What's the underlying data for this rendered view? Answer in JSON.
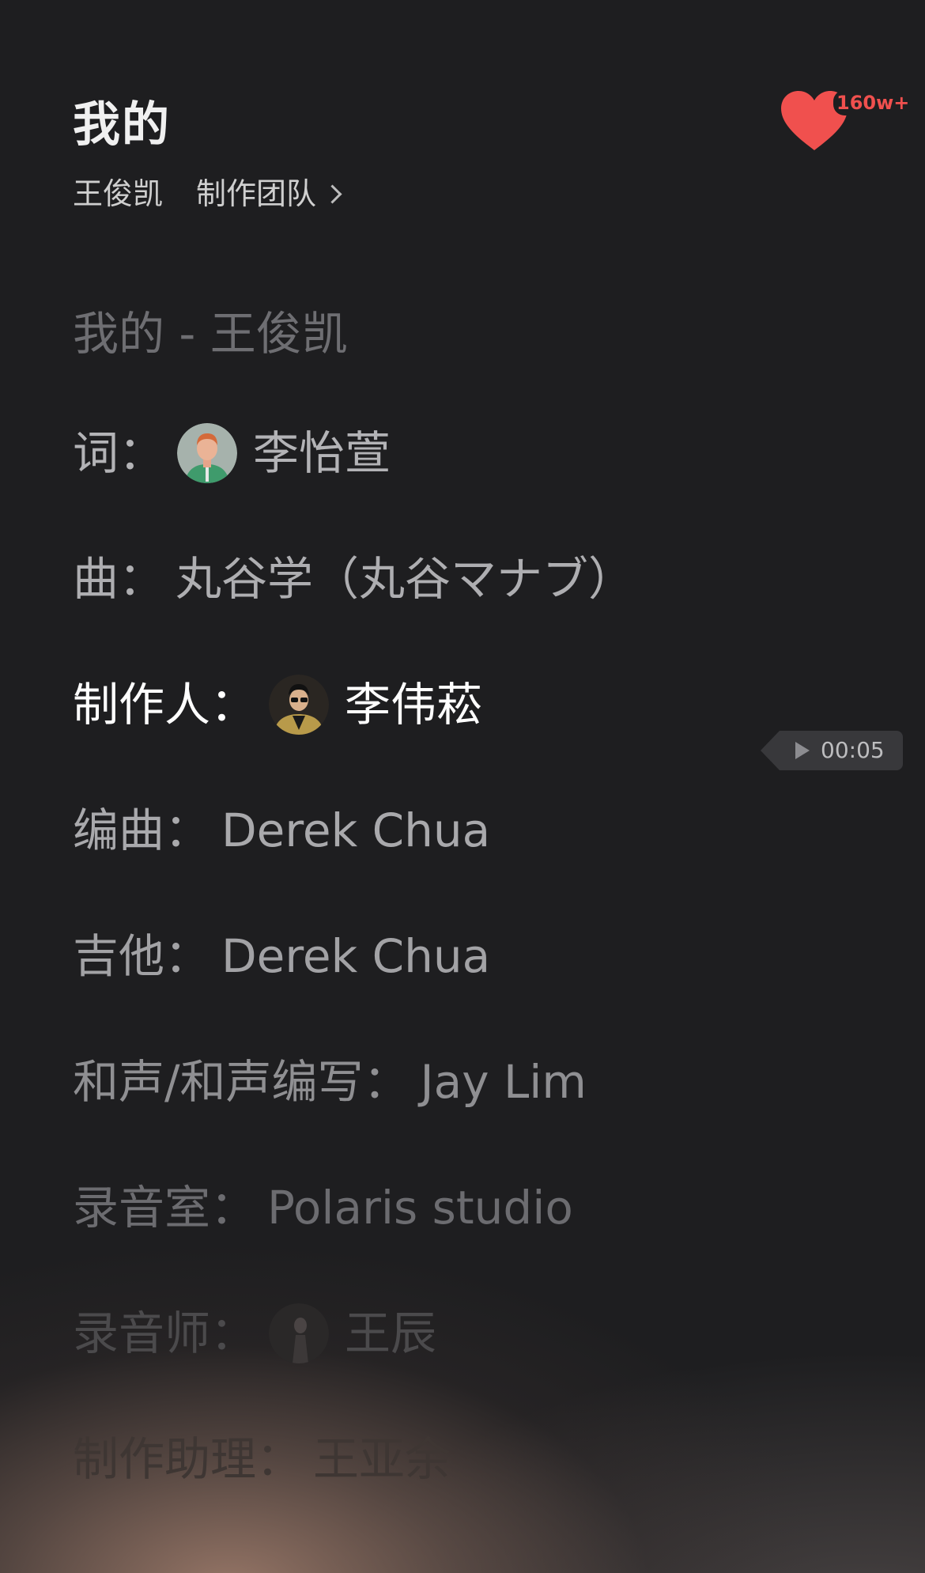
{
  "header": {
    "song_title": "我的",
    "artist": "王俊凯",
    "team_link": "制作团队"
  },
  "like": {
    "count": "160w+",
    "color": "#f0504e"
  },
  "player": {
    "time": "00:05"
  },
  "credits": [
    {
      "text": "我的 - 王俊凯"
    },
    {
      "role": "词：",
      "name": "李怡萱",
      "avatar": "avatar-illustrated-man"
    },
    {
      "role": "曲：",
      "name": "丸谷学（丸谷マナブ）"
    },
    {
      "role": "制作人：",
      "name": "李伟菘",
      "avatar": "avatar-photo-man"
    },
    {
      "role": "编曲：",
      "name": "Derek Chua"
    },
    {
      "role": "吉他：",
      "name": "Derek Chua"
    },
    {
      "role": "和声/和声编写：",
      "name": "Jay Lim"
    },
    {
      "role": "录音室：",
      "name": "Polaris studio"
    },
    {
      "role": "录音师：",
      "name": "王辰",
      "avatar": "avatar-photo-dark"
    },
    {
      "role": "制作助理：",
      "name": "王亚余"
    }
  ],
  "colors": {
    "background": "#1e1e20",
    "active_line": "#ffffff"
  }
}
